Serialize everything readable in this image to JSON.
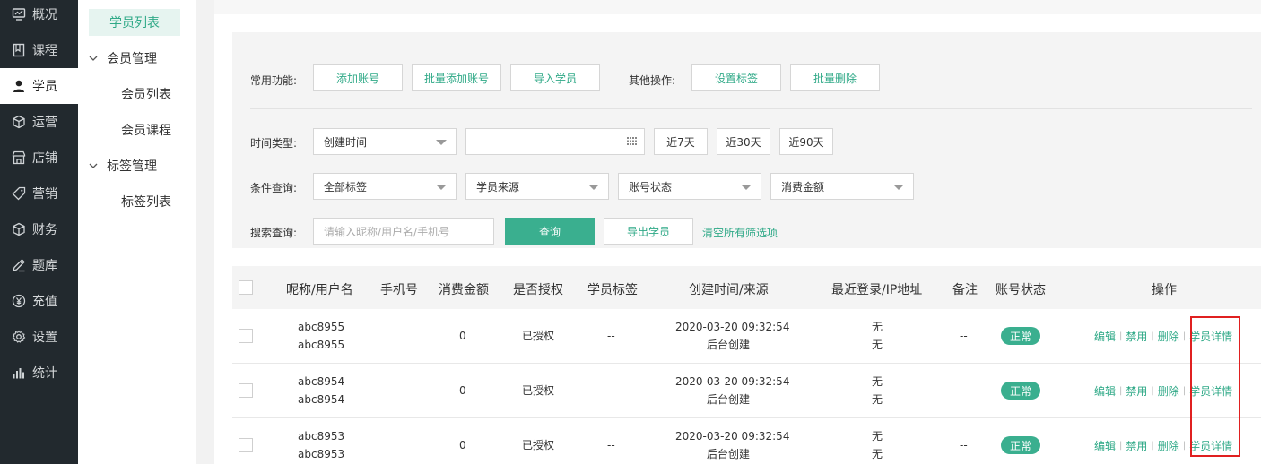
{
  "nav": {
    "items": [
      {
        "label": "概况",
        "icon": "monitor-icon"
      },
      {
        "label": "课程",
        "icon": "book-icon"
      },
      {
        "label": "学员",
        "icon": "user-icon"
      },
      {
        "label": "运营",
        "icon": "cube-icon"
      },
      {
        "label": "店铺",
        "icon": "store-icon"
      },
      {
        "label": "营销",
        "icon": "tag-icon"
      },
      {
        "label": "财务",
        "icon": "cube-icon"
      },
      {
        "label": "题库",
        "icon": "pencil-icon"
      },
      {
        "label": "充值",
        "icon": "yen-icon"
      },
      {
        "label": "设置",
        "icon": "gear-icon"
      },
      {
        "label": "统计",
        "icon": "bar-chart-icon"
      }
    ],
    "active": "学员"
  },
  "subnav": {
    "active_item": "学员列表",
    "groups": [
      {
        "label": "会员管理",
        "items": [
          "会员列表",
          "会员课程"
        ]
      },
      {
        "label": "标签管理",
        "items": [
          "标签列表"
        ]
      }
    ]
  },
  "filters": {
    "common_label": "常用功能:",
    "common_buttons": [
      "添加账号",
      "批量添加账号",
      "导入学员"
    ],
    "other_label": "其他操作:",
    "other_buttons": [
      "设置标签",
      "批量删除"
    ],
    "time_label": "时间类型:",
    "time_type": "创建时间",
    "date_range_value": "",
    "quick_ranges": [
      "近7天",
      "近30天",
      "近90天"
    ],
    "cond_label": "条件查询:",
    "cond_selects": [
      "全部标签",
      "学员来源",
      "账号状态",
      "消费金额"
    ],
    "search_label": "搜索查询:",
    "search_placeholder": "请输入昵称/用户名/手机号",
    "query_button": "查询",
    "export_button": "导出学员",
    "clear_link": "清空所有筛选项"
  },
  "table": {
    "headers": [
      "昵称/用户名",
      "手机号",
      "消费金额",
      "是否授权",
      "学员标签",
      "创建时间/来源",
      "最近登录/IP地址",
      "备注",
      "账号状态",
      "操作"
    ],
    "rows": [
      {
        "nickname": "abc8955",
        "username": "abc8955",
        "phone": "",
        "amount": "0",
        "auth": "已授权",
        "tag": "--",
        "created": "2020-03-20 09:32:54",
        "source": "后台创建",
        "last_login": "无",
        "ip": "无",
        "remark": "--",
        "status": "正常"
      },
      {
        "nickname": "abc8954",
        "username": "abc8954",
        "phone": "",
        "amount": "0",
        "auth": "已授权",
        "tag": "--",
        "created": "2020-03-20 09:32:54",
        "source": "后台创建",
        "last_login": "无",
        "ip": "无",
        "remark": "--",
        "status": "正常"
      },
      {
        "nickname": "abc8953",
        "username": "abc8953",
        "phone": "",
        "amount": "0",
        "auth": "已授权",
        "tag": "--",
        "created": "2020-03-20 09:32:54",
        "source": "后台创建",
        "last_login": "无",
        "ip": "无",
        "remark": "--",
        "status": "正常"
      }
    ],
    "actions": [
      "编辑",
      "禁用",
      "删除",
      "学员详情"
    ]
  },
  "colors": {
    "accent": "#3aaf8f",
    "nav_bg": "#22292e",
    "highlight": "#e02020"
  }
}
